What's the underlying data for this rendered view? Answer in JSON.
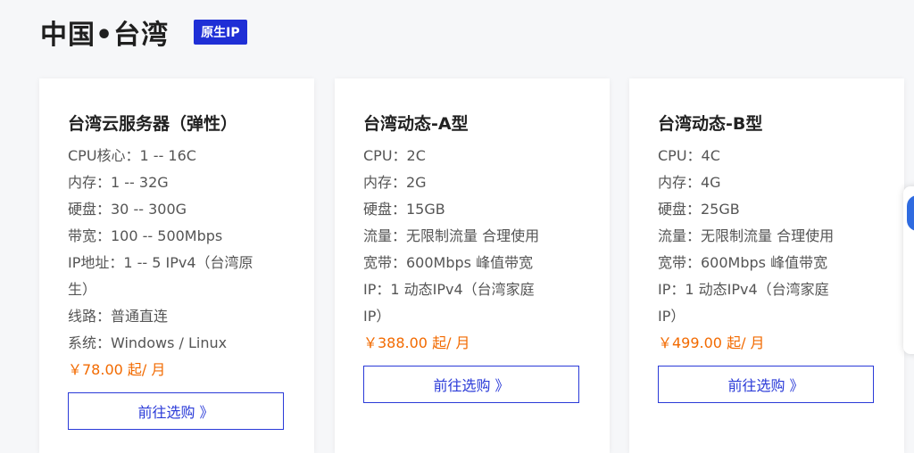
{
  "header": {
    "title": "中国•台湾",
    "badge": "原生IP"
  },
  "cards": [
    {
      "title": "台湾云服务器（弹性）",
      "specs": [
        "CPU核心：1 -- 16C",
        "内存：1 -- 32G",
        "硬盘：30 -- 300G",
        "带宽：100 -- 500Mbps",
        "IP地址：1 -- 5 IPv4（台湾原",
        "生）",
        "线路：普通直连",
        "系统：Windows / Linux"
      ],
      "price": "￥78.00 起/ 月",
      "button": "前往选购 》"
    },
    {
      "title": "台湾动态-A型",
      "specs": [
        "CPU：2C",
        "内存：2G",
        "硬盘：15GB",
        "流量：无限制流量 合理使用",
        "宽带：600Mbps 峰值带宽",
        "IP：1 动态IPv4（台湾家庭",
        "IP）"
      ],
      "price": "￥388.00 起/ 月",
      "button": "前往选购 》"
    },
    {
      "title": "台湾动态-B型",
      "specs": [
        "CPU：4C",
        "内存：4G",
        "硬盘：25GB",
        "流量：无限制流量 合理使用",
        "宽带：600Mbps 峰值带宽",
        "IP：1 动态IPv4（台湾家庭",
        "IP）"
      ],
      "price": "￥499.00 起/ 月",
      "button": "前往选购 》"
    }
  ],
  "colors": {
    "accent": "#2a3ad8",
    "price": "#f26a00",
    "badge_bg": "#1f2fd6"
  }
}
